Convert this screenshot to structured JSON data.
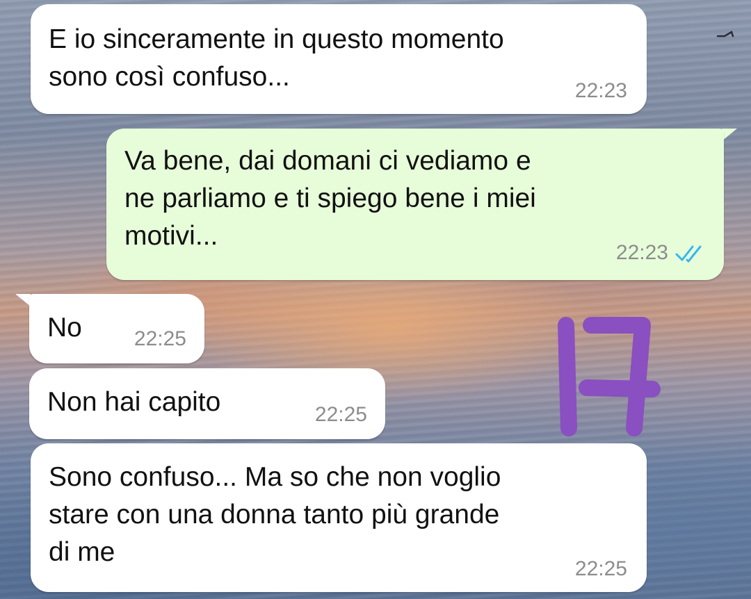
{
  "messages": [
    {
      "direction": "incoming",
      "text": "E io sinceramente in questo momento\nsono così confuso...",
      "time": "22:23"
    },
    {
      "direction": "outgoing",
      "text": "Va bene, dai domani ci vediamo e\nne parliamo e ti spiego bene i miei\nmotivi...",
      "time": "22:23",
      "status_icon": "double-check-read-icon"
    },
    {
      "direction": "incoming",
      "text": "No",
      "time": "22:25"
    },
    {
      "direction": "incoming",
      "text": "Non hai capito",
      "time": "22:25"
    },
    {
      "direction": "incoming",
      "text": "Sono confuso... Ma so che non voglio\nstare con una donna tanto più grande\ndi me",
      "time": "22:25"
    }
  ],
  "overlay": {
    "handwritten_annotation": "17",
    "annotation_color": "#8a4fc0"
  },
  "colors": {
    "incoming_bubble": "#ffffff",
    "outgoing_bubble": "#e7fdd9",
    "timestamp": "#8c8c8c",
    "read_ticks": "#34b7f1"
  }
}
